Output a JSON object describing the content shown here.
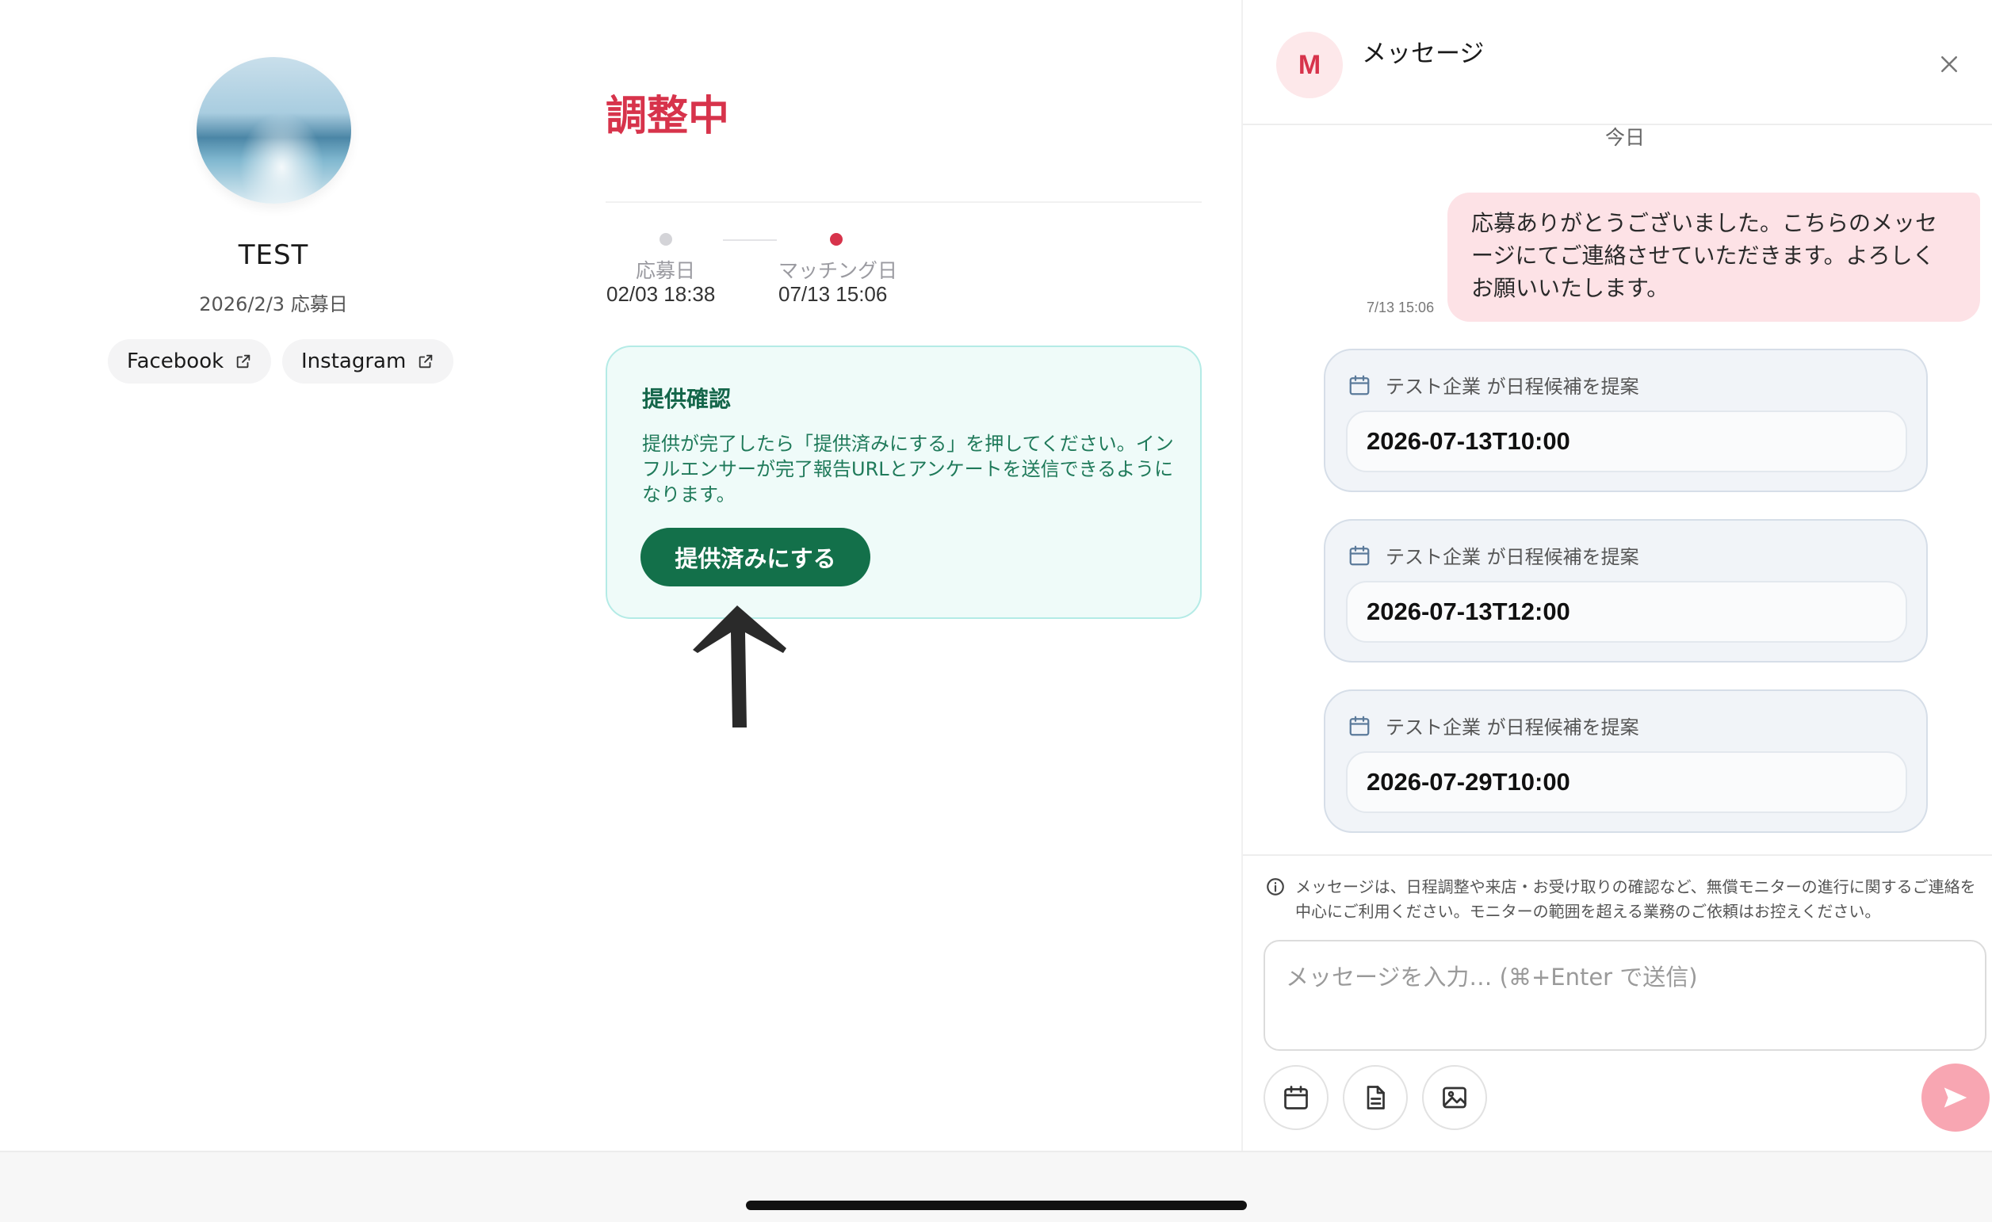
{
  "profile": {
    "name": "TEST",
    "applied_date": "2026/2/3 応募日",
    "links": [
      {
        "label": "Facebook",
        "icon": "external-link-icon"
      },
      {
        "label": "Instagram",
        "icon": "external-link-icon"
      }
    ]
  },
  "status": {
    "title": "調整中",
    "color": "#d7334b"
  },
  "timeline": [
    {
      "label": "応募日",
      "time": "02/03 18:38",
      "dot_color": "#d4d4d8"
    },
    {
      "label": "マッチング日",
      "time": "07/13 15:06",
      "dot_color": "#d7334b"
    }
  ],
  "confirm_card": {
    "title": "提供確認",
    "text": "提供が完了したら「提供済みにする」を押してください。インフルエンサーが完了報告URLとアンケートを送信できるようになります。",
    "button_label": "提供済みにする"
  },
  "chat": {
    "avatar_letter": "M",
    "title": "メッセージ",
    "day_label": "今日",
    "message": {
      "time": "7/13 15:06",
      "text": "応募ありがとうございました。こちらのメッセージにてご連絡させていただきます。よろしくお願いいたします。"
    },
    "proposals": [
      {
        "header": "テスト企業 が日程候補を提案",
        "value": "2026-07-13T10:00"
      },
      {
        "header": "テスト企業 が日程候補を提案",
        "value": "2026-07-13T12:00"
      },
      {
        "header": "テスト企業 が日程候補を提案",
        "value": "2026-07-29T10:00"
      }
    ],
    "notice": "メッセージは、日程調整や来店・お受け取りの確認など、無償モニターの進行に関するご連絡を中心にご利用ください。モニターの範囲を超える業務のご依頼はお控えください。",
    "input_placeholder": "メッセージを入力… (⌘+Enter で送信)",
    "tools": [
      "calendar-icon",
      "document-icon",
      "image-icon"
    ],
    "send_color": "#f8a6b2"
  },
  "colors": {
    "brand_green": "#13704a",
    "brand_red": "#d7334b"
  }
}
